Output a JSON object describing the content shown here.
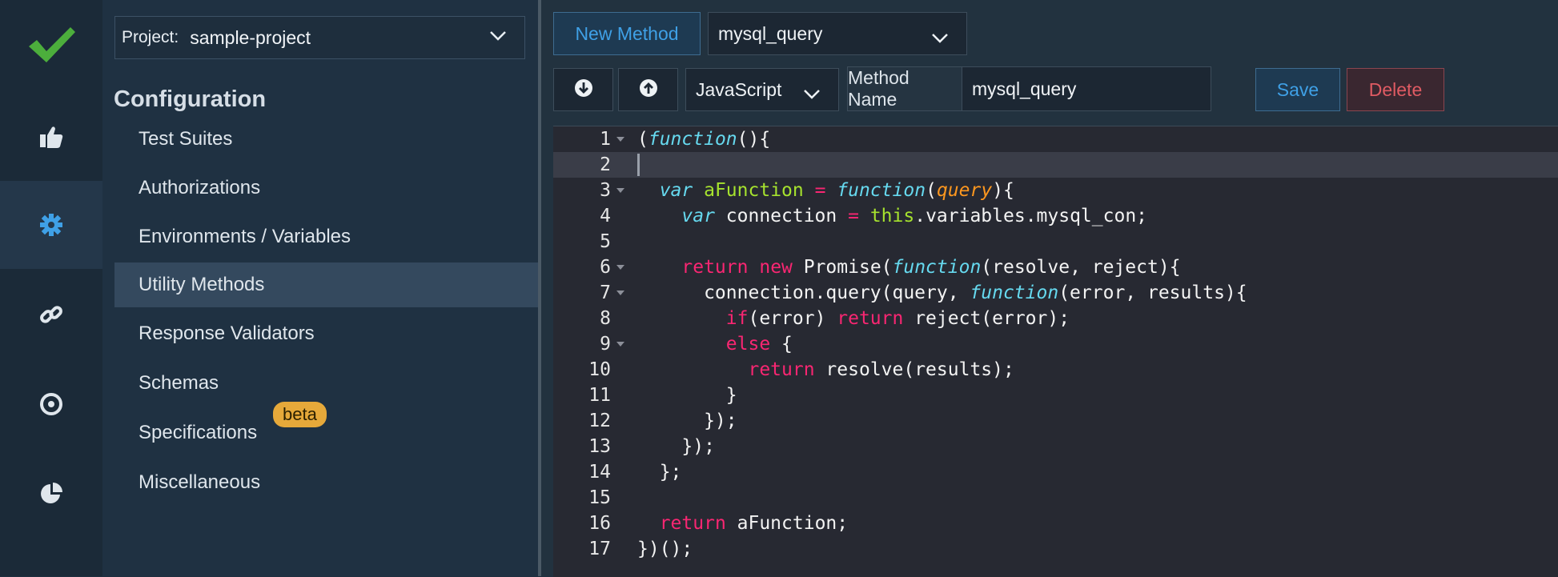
{
  "rail": {
    "items": [
      {
        "name": "logo-check-icon"
      },
      {
        "name": "thumbs-up-icon"
      },
      {
        "name": "gear-icon"
      },
      {
        "name": "link-icon"
      },
      {
        "name": "target-icon"
      },
      {
        "name": "pie-chart-icon"
      }
    ]
  },
  "sidebar": {
    "project_label": "Project:",
    "project_value": "sample-project",
    "heading": "Configuration",
    "items": [
      {
        "label": "Test Suites"
      },
      {
        "label": "Authorizations"
      },
      {
        "label": "Environments / Variables"
      },
      {
        "label": "Utility Methods",
        "selected": true
      },
      {
        "label": "Response Validators"
      },
      {
        "label": "Schemas"
      },
      {
        "label": "Specifications",
        "badge": "beta"
      },
      {
        "label": "Miscellaneous"
      }
    ]
  },
  "toolbar": {
    "new_method_label": "New Method",
    "method_selected": "mysql_query",
    "language_selected": "JavaScript",
    "method_name_label": "Method Name",
    "method_name_value": "mysql_query",
    "save_label": "Save",
    "delete_label": "Delete"
  },
  "editor": {
    "active_line": 2,
    "lines": [
      {
        "n": "1",
        "fold": true
      },
      {
        "n": "2",
        "fold": false
      },
      {
        "n": "3",
        "fold": true
      },
      {
        "n": "4",
        "fold": false
      },
      {
        "n": "5",
        "fold": false
      },
      {
        "n": "6",
        "fold": true
      },
      {
        "n": "7",
        "fold": true
      },
      {
        "n": "8",
        "fold": false
      },
      {
        "n": "9",
        "fold": true
      },
      {
        "n": "10",
        "fold": false
      },
      {
        "n": "11",
        "fold": false
      },
      {
        "n": "12",
        "fold": false
      },
      {
        "n": "13",
        "fold": false
      },
      {
        "n": "14",
        "fold": false
      },
      {
        "n": "15",
        "fold": false
      },
      {
        "n": "16",
        "fold": false
      },
      {
        "n": "17",
        "fold": false
      }
    ],
    "tokens": {
      "l1": [
        "(",
        "function",
        "(){"
      ],
      "l3": [
        "  ",
        "var",
        " ",
        "aFunction",
        " ",
        "=",
        " ",
        "function",
        "(",
        "query",
        "){"
      ],
      "l4": [
        "    ",
        "var",
        " connection ",
        "=",
        " ",
        "this",
        ".variables.mysql_con;"
      ],
      "l6": [
        "    ",
        "return",
        " ",
        "new",
        " Promise(",
        "function",
        "(resolve, reject){"
      ],
      "l7": [
        "      connection.query(query, ",
        "function",
        "(error, results){"
      ],
      "l8": [
        "        ",
        "if",
        "(error) ",
        "return",
        " reject(error);"
      ],
      "l9": [
        "        ",
        "else",
        " {"
      ],
      "l10": [
        "          ",
        "return",
        " resolve(results);"
      ],
      "l11": [
        "        }"
      ],
      "l12": [
        "      });"
      ],
      "l13": [
        "    });"
      ],
      "l14": [
        "  };"
      ],
      "l16": [
        "  ",
        "return",
        " aFunction;"
      ],
      "l17": [
        "})();"
      ]
    }
  }
}
